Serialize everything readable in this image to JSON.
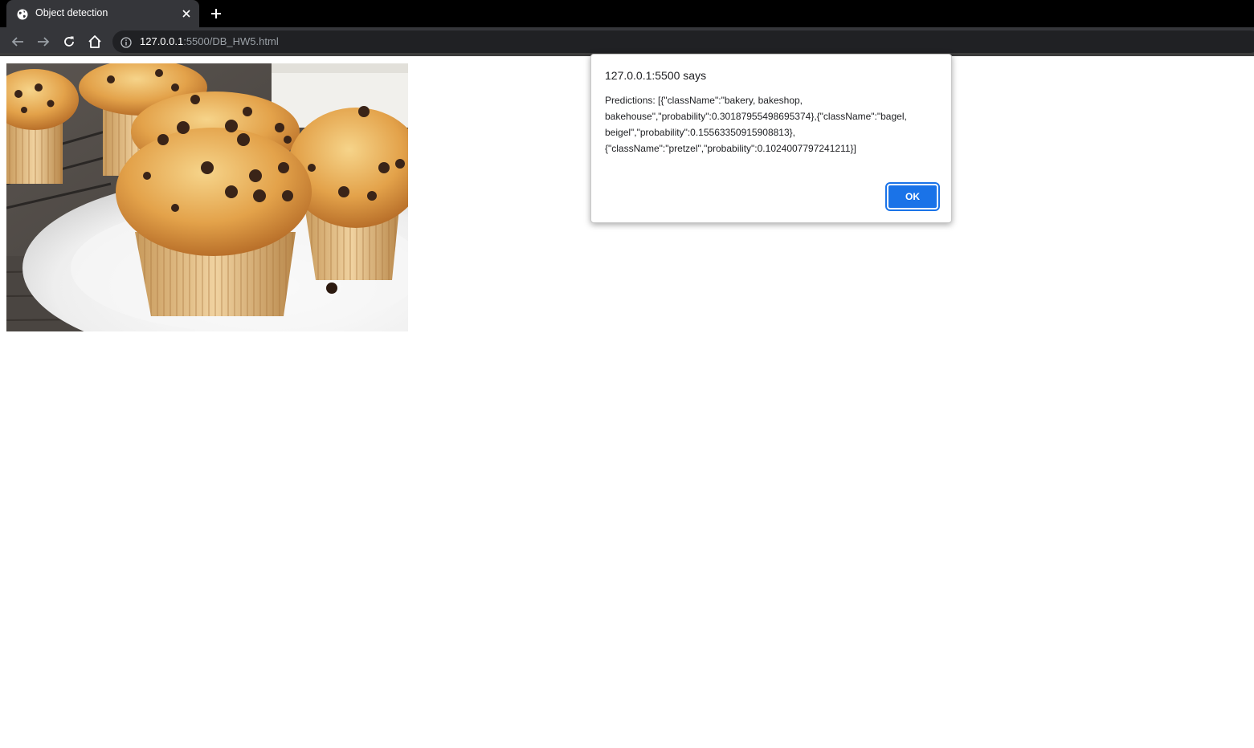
{
  "browser": {
    "tab": {
      "title": "Object detection",
      "favicon": "globe-icon",
      "close_icon": "close-icon"
    },
    "new_tab_icon": "plus-icon",
    "nav": {
      "back_icon": "arrow-left-icon",
      "forward_icon": "arrow-right-icon",
      "reload_icon": "reload-icon",
      "home_icon": "home-icon"
    },
    "address": {
      "info_icon": "info-icon",
      "host": "127.0.0.1",
      "path": ":5500/DB_HW5.html"
    }
  },
  "page": {
    "image_subject": "chocolate-chip-muffins-on-plate"
  },
  "dialog": {
    "title": "127.0.0.1:5500 says",
    "message": "Predictions: [{\"className\":\"bakery, bakeshop,\nbakehouse\",\"probability\":0.30187955498695374},{\"className\":\"bagel,\nbeigel\",\"probability\":0.15563350915908813},\n{\"className\":\"pretzel\",\"probability\":0.1024007797241211}]",
    "ok_label": "OK"
  },
  "colors": {
    "tabstrip": "#000000",
    "toolbar": "#35363a",
    "omnibox": "#202124",
    "accent": "#1a73e8"
  }
}
